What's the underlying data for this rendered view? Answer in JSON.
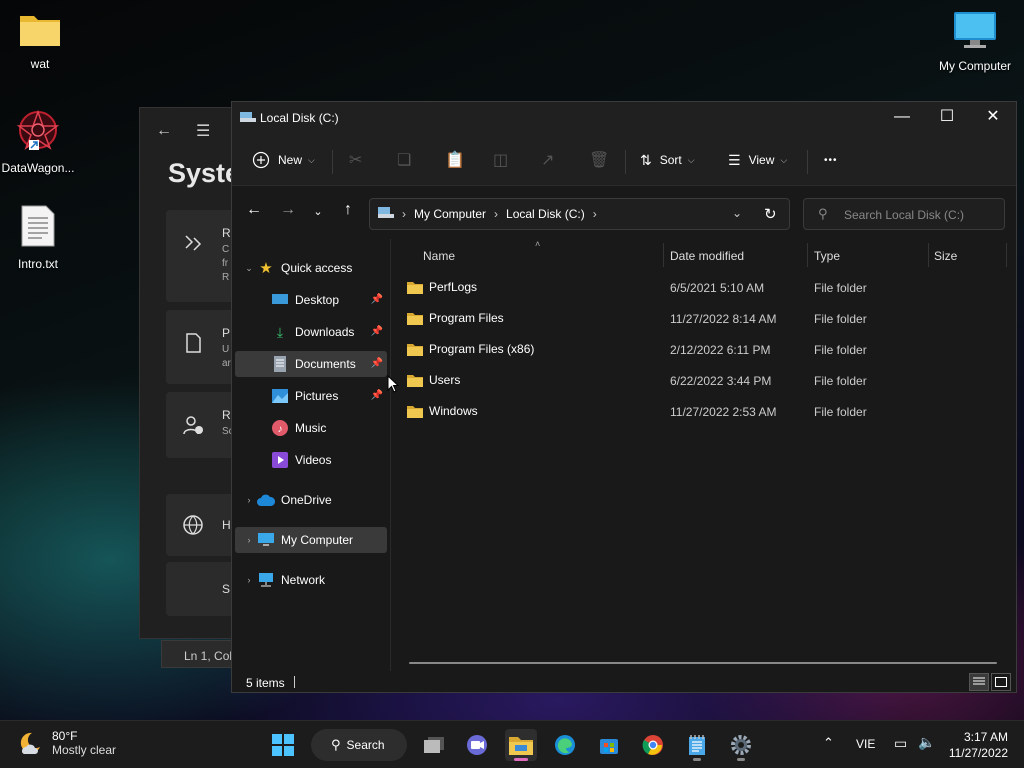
{
  "desktop": {
    "icons": [
      {
        "label": "wat"
      },
      {
        "label": "DataWagon..."
      },
      {
        "label": "Intro.txt"
      },
      {
        "label": "My Computer"
      }
    ]
  },
  "bg_window": {
    "title": "Syste",
    "cards": [
      {
        "title": "R",
        "sub1": "C",
        "sub2": "fr",
        "sub3": "R"
      },
      {
        "title": "P",
        "sub1": "U",
        "sub2": "ar"
      },
      {
        "title": "R",
        "sub1": "Sc"
      },
      {
        "title": "H"
      },
      {
        "title": "S"
      }
    ],
    "status": "Ln 1, Col"
  },
  "explorer": {
    "title": "Local Disk (C:)",
    "toolbar": {
      "new_label": "New",
      "sort_label": "Sort",
      "view_label": "View",
      "more_label": "•••"
    },
    "breadcrumb": [
      "My Computer",
      "Local Disk (C:)"
    ],
    "search_placeholder": "Search Local Disk (C:)",
    "sidebar": {
      "quick_access": "Quick access",
      "pinned": [
        {
          "label": "Desktop"
        },
        {
          "label": "Downloads"
        },
        {
          "label": "Documents"
        },
        {
          "label": "Pictures"
        }
      ],
      "other": [
        {
          "label": "Music"
        },
        {
          "label": "Videos"
        }
      ],
      "onedrive": "OneDrive",
      "my_computer": "My Computer",
      "network": "Network"
    },
    "columns": {
      "name": "Name",
      "date": "Date modified",
      "type": "Type",
      "size": "Size"
    },
    "rows": [
      {
        "name": "PerfLogs",
        "date": "6/5/2021 5:10 AM",
        "type": "File folder"
      },
      {
        "name": "Program Files",
        "date": "11/27/2022 8:14 AM",
        "type": "File folder"
      },
      {
        "name": "Program Files (x86)",
        "date": "2/12/2022 6:11 PM",
        "type": "File folder"
      },
      {
        "name": "Users",
        "date": "6/22/2022 3:44 PM",
        "type": "File folder"
      },
      {
        "name": "Windows",
        "date": "11/27/2022 2:53 AM",
        "type": "File folder"
      }
    ],
    "status": "5 items"
  },
  "taskbar": {
    "weather_temp": "80°F",
    "weather_cond": "Mostly clear",
    "search_label": "Search",
    "lang": "VIE",
    "time": "3:17 AM",
    "date": "11/27/2022"
  },
  "colors": {
    "folder": "#f0c850",
    "accent": "#60cdff",
    "taskbar_active": "#e06cc0"
  }
}
